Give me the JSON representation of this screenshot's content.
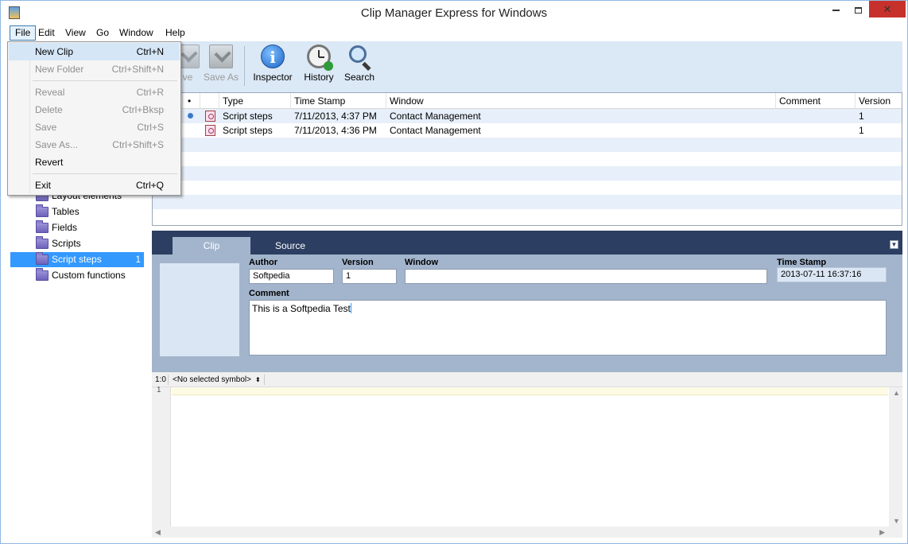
{
  "window": {
    "title": "Clip Manager Express for Windows"
  },
  "menubar": [
    {
      "label": "File",
      "active": true
    },
    {
      "label": "Edit"
    },
    {
      "label": "View"
    },
    {
      "label": "Go"
    },
    {
      "label": "Window"
    },
    {
      "label": "Help"
    }
  ],
  "toolbar": {
    "save_label": "ve",
    "save_as_label": "Save As",
    "inspector_label": "Inspector",
    "history_label": "History",
    "search_label": "Search"
  },
  "file_menu": {
    "items": [
      {
        "label": "New Clip",
        "shortcut": "Ctrl+N",
        "enabled": true
      },
      {
        "label": "New Folder",
        "shortcut": "Ctrl+Shift+N",
        "enabled": false
      },
      {
        "label": "Reveal",
        "shortcut": "Ctrl+R",
        "enabled": false
      },
      {
        "label": "Delete",
        "shortcut": "Ctrl+Bksp",
        "enabled": false
      },
      {
        "label": "Save",
        "shortcut": "Ctrl+S",
        "enabled": false
      },
      {
        "label": "Save As...",
        "shortcut": "Ctrl+Shift+S",
        "enabled": false
      },
      {
        "label": "Revert",
        "shortcut": "",
        "enabled": true
      },
      {
        "label": "Exit",
        "shortcut": "Ctrl+Q",
        "enabled": true
      }
    ]
  },
  "sidebar": {
    "items": [
      {
        "label": "Layout elements"
      },
      {
        "label": "Tables"
      },
      {
        "label": "Fields"
      },
      {
        "label": "Scripts"
      },
      {
        "label": "Script steps",
        "count": "1",
        "selected": true
      },
      {
        "label": "Custom functions"
      }
    ]
  },
  "list": {
    "columns": {
      "dot": "•",
      "type": "Type",
      "timestamp": "Time Stamp",
      "window": "Window",
      "comment": "Comment",
      "version": "Version"
    },
    "rows": [
      {
        "type": "Script steps",
        "timestamp": "7/11/2013, 4:37 PM",
        "window": "Contact Management",
        "comment": "",
        "version": "1"
      },
      {
        "type": "Script steps",
        "timestamp": "7/11/2013, 4:36 PM",
        "window": "Contact Management",
        "comment": "",
        "version": "1"
      }
    ]
  },
  "detail": {
    "tabs": [
      {
        "label": "Clip"
      },
      {
        "label": "Source"
      }
    ],
    "author_label": "Author",
    "author_value": "Softpedia",
    "version_label": "Version",
    "version_value": "1",
    "window_label": "Window",
    "window_value": "",
    "timestamp_label": "Time Stamp",
    "timestamp_value": "2013-07-11 16:37:16",
    "comment_label": "Comment",
    "comment_value": "This is a Softpedia Test"
  },
  "editor": {
    "position": "1:0",
    "symbol": "<No selected symbol>",
    "line_number": "1"
  }
}
